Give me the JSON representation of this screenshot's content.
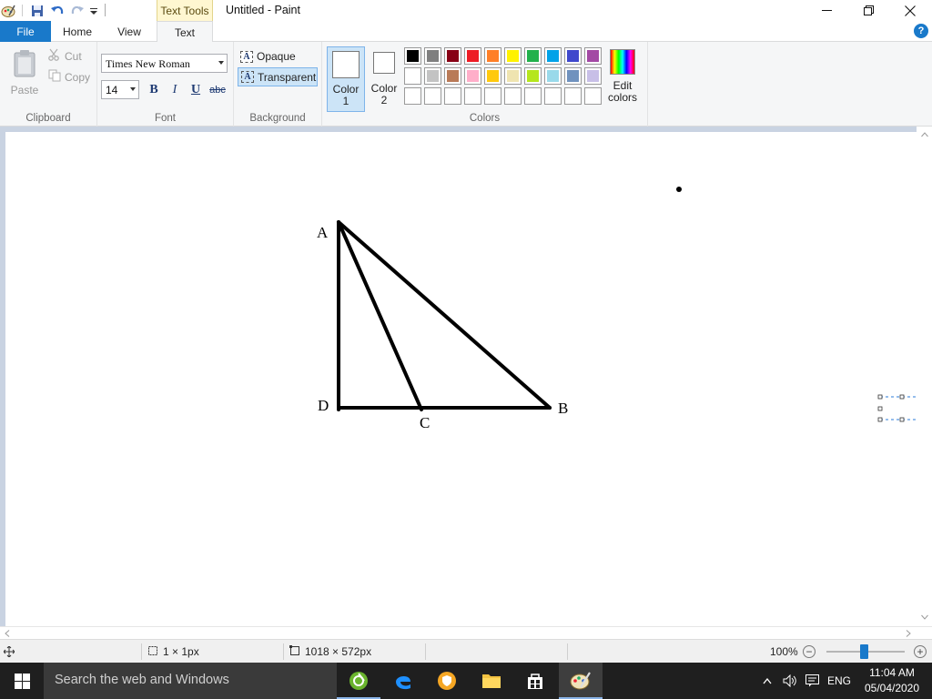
{
  "titlebar": {
    "contextual_tab": "Text Tools",
    "title": "Untitled - Paint"
  },
  "tabs": {
    "file": "File",
    "home": "Home",
    "view": "View",
    "text": "Text"
  },
  "clipboard": {
    "paste": "Paste",
    "cut": "Cut",
    "copy": "Copy",
    "label": "Clipboard"
  },
  "font": {
    "family": "Times New Roman",
    "size": "14",
    "bold": "B",
    "italic": "I",
    "underline": "U",
    "strikethrough": "abc",
    "label": "Font"
  },
  "background": {
    "opaque": "Opaque",
    "transparent": "Transparent",
    "label": "Background"
  },
  "colors": {
    "color1_line1": "Color",
    "color1_line2": "1",
    "color2_line1": "Color",
    "color2_line2": "2",
    "edit_line1": "Edit",
    "edit_line2": "colors",
    "label": "Colors",
    "color1_value": "#ffffff",
    "color2_value": "#ffffff",
    "palette_row1": [
      "#000000",
      "#7f7f7f",
      "#880015",
      "#ed1c24",
      "#ff7f27",
      "#fff200",
      "#22b14c",
      "#00a2e8",
      "#3f48cc",
      "#a349a4"
    ],
    "palette_row2": [
      "#ffffff",
      "#c3c3c3",
      "#b97a57",
      "#ffaec9",
      "#ffc90e",
      "#efe4b0",
      "#b5e61d",
      "#99d9ea",
      "#7092be",
      "#c8bfe7"
    ],
    "palette_row3_empty": 10
  },
  "canvas": {
    "labels": {
      "a": "A",
      "b": "B",
      "c": "C",
      "d": "D"
    }
  },
  "statusbar": {
    "selection_size": "1 × 1px",
    "canvas_size": "1018 × 572px",
    "zoom": "100%",
    "zoom_level": 0.48
  },
  "taskbar": {
    "search_placeholder": "Search the web and Windows",
    "language": "ENG",
    "time": "11:04 AM",
    "date": "05/04/2020"
  }
}
